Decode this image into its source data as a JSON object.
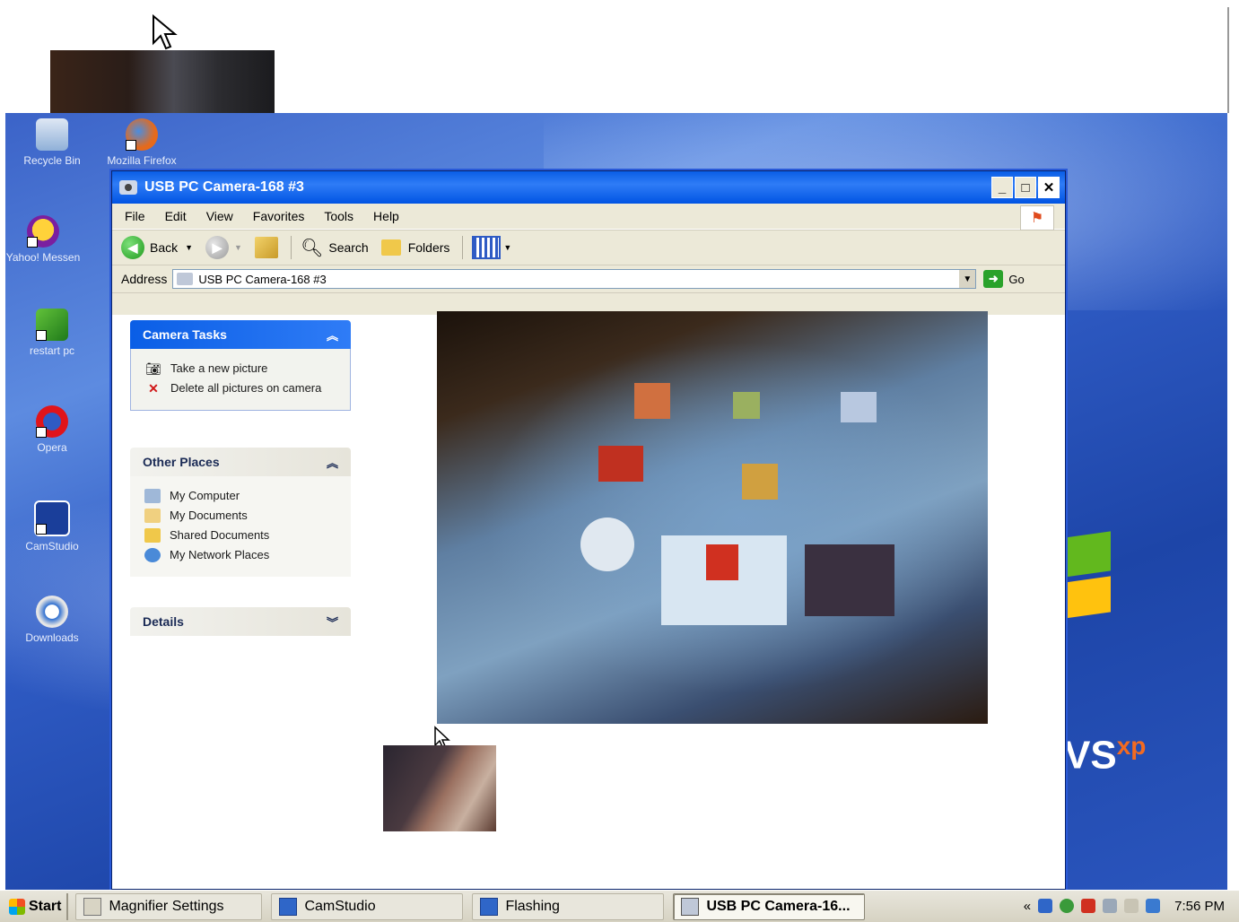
{
  "desktop": {
    "icons": [
      {
        "label": "Recycle Bin"
      },
      {
        "label": "Mozilla Firefox"
      },
      {
        "label": "Yahoo! Messen"
      },
      {
        "label": "restart pc"
      },
      {
        "label": "Opera"
      },
      {
        "label": "CamStudio"
      },
      {
        "label": "Downloads"
      }
    ],
    "wallpaper_text": "VS",
    "wallpaper_sup": "xp"
  },
  "window": {
    "title": "USB PC Camera-168 #3",
    "buttons": {
      "minimize": "_",
      "maximize": "□",
      "close": "✕"
    },
    "menu": [
      "File",
      "Edit",
      "View",
      "Favorites",
      "Tools",
      "Help"
    ],
    "toolbar": {
      "back": "Back",
      "search": "Search",
      "folders": "Folders"
    },
    "address": {
      "label": "Address",
      "value": "USB PC Camera-168 #3",
      "go": "Go"
    },
    "camera_tasks": {
      "title": "Camera Tasks",
      "items": [
        "Take a new picture",
        "Delete all pictures on camera"
      ]
    },
    "other_places": {
      "title": "Other Places",
      "items": [
        "My Computer",
        "My Documents",
        "Shared Documents",
        "My Network Places"
      ]
    },
    "details": {
      "title": "Details"
    }
  },
  "taskbar": {
    "start": "Start",
    "tasks": [
      {
        "label": "Magnifier Settings"
      },
      {
        "label": "CamStudio"
      },
      {
        "label": "Flashing"
      },
      {
        "label": "USB PC Camera-16..."
      }
    ],
    "tray_chevron": "«",
    "clock": "7:56 PM"
  },
  "colors": {
    "xp_blue": "#0054e3",
    "desktop": "#3b63c8",
    "panel_border": "#9fb3e0"
  }
}
